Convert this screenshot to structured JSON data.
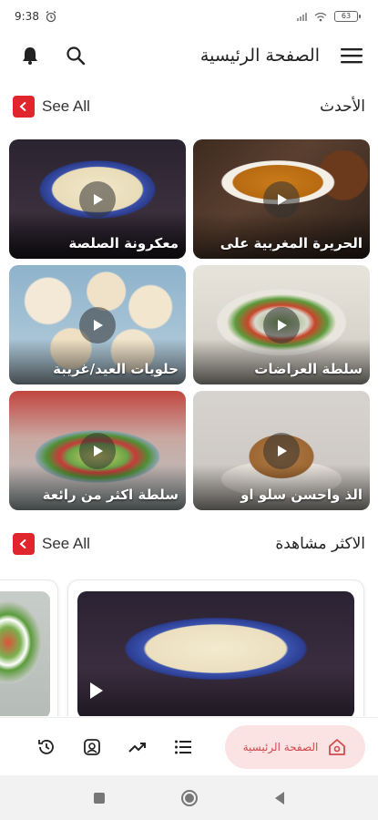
{
  "status_bar": {
    "time": "9:38",
    "battery": "63"
  },
  "app_bar": {
    "title": "الصفحة الرئيسية"
  },
  "latest": {
    "title": "الأحدث",
    "see_all": "See All",
    "items": [
      {
        "caption": "الحريرة المغربية على"
      },
      {
        "caption": "معكرونة الصلصة"
      },
      {
        "caption": "سلطة العراضات"
      },
      {
        "caption": "حلويات العيد/غريبة"
      },
      {
        "caption": "الذ واحسن سلو او"
      },
      {
        "caption": "سلطة اكثر من رائعة"
      }
    ]
  },
  "most_viewed": {
    "title": "الاكثر مشاهدة",
    "see_all": "See All"
  },
  "bottom_nav": {
    "home_label": "الصفحة الرئيسية",
    "icons": [
      "history-icon",
      "gallery-icon",
      "trending-icon",
      "list-icon",
      "home-icon"
    ]
  },
  "colors": {
    "accent": "#e1252d",
    "home_pill": "#fbe3e4",
    "home_text": "#d04a50"
  }
}
